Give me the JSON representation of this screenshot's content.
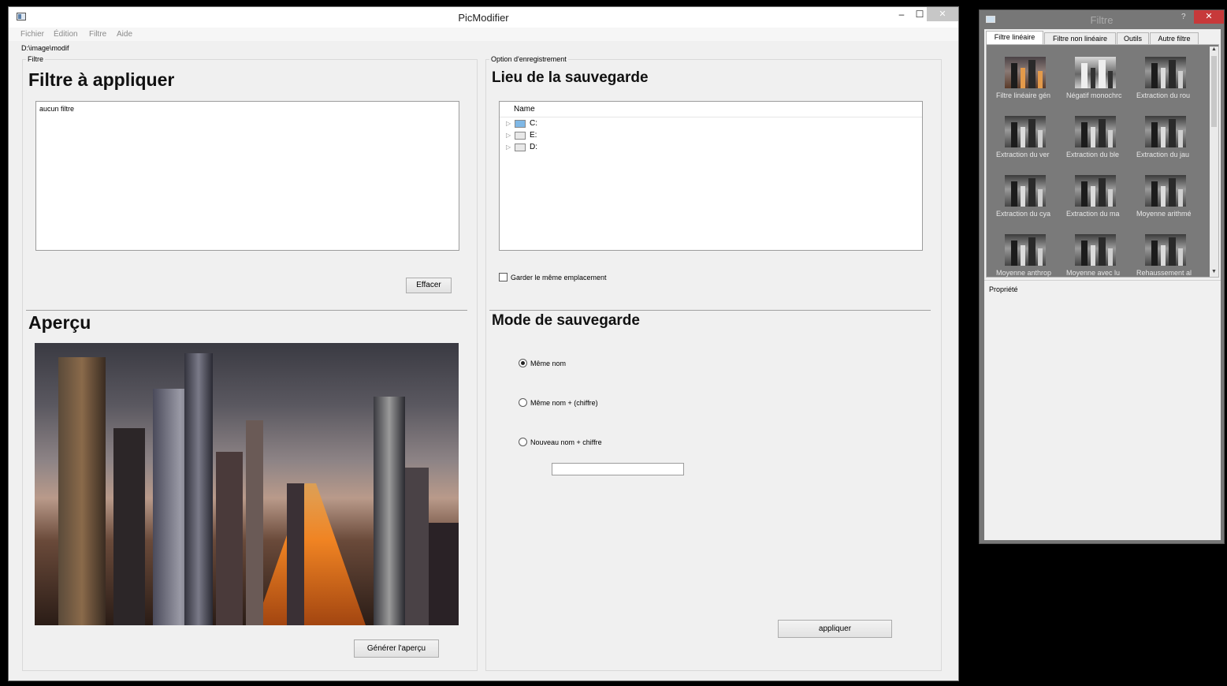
{
  "main_window": {
    "title": "PicModifier",
    "controls": {
      "minimize": "–",
      "maximize": "☐",
      "close": "✕"
    },
    "menu": [
      "Fichier",
      "Édition",
      "Filtre",
      "Aide"
    ],
    "path": "D:\\image\\modif"
  },
  "filter_group": {
    "group_title": "Filtre",
    "heading": "Filtre à appliquer",
    "list_items": [
      "aucun filtre"
    ],
    "clear_button": "Effacer"
  },
  "preview_section": {
    "heading": "Aperçu",
    "generate_button": "Générer l'aperçu"
  },
  "save_group": {
    "group_title": "Option d'enregistrement",
    "location_heading": "Lieu de la sauvegarde",
    "tree_header": "Name",
    "drives": [
      "C:",
      "E:",
      "D:"
    ],
    "keep_location_label": "Garder le même emplacement",
    "keep_location_checked": false,
    "mode_heading": "Mode de sauvegarde",
    "modes": [
      "Même nom",
      "Même nom + (chiffre)",
      "Nouveau nom + chiffre"
    ],
    "selected_mode": "Même nom",
    "new_name_value": "",
    "apply_button": "appliquer"
  },
  "filter_window": {
    "title": "Filtre",
    "help": "?",
    "close": "✕",
    "tabs": [
      "Filtre linéaire",
      "Filtre non linéaire",
      "Outils",
      "Autre filtre"
    ],
    "active_tab": "Filtre linéaire",
    "items": [
      "Filtre linéaire gén",
      "Négatif monochrc",
      "Extraction du rou",
      "Extraction du ver",
      "Extraction du ble",
      "Extraction du jau",
      "Extraction du cya",
      "Extraction du ma",
      "Moyenne arithmé",
      "Moyenne anthrop",
      "Moyenne avec lu",
      "Rehaussement al"
    ],
    "properties_label": "Propriété"
  }
}
